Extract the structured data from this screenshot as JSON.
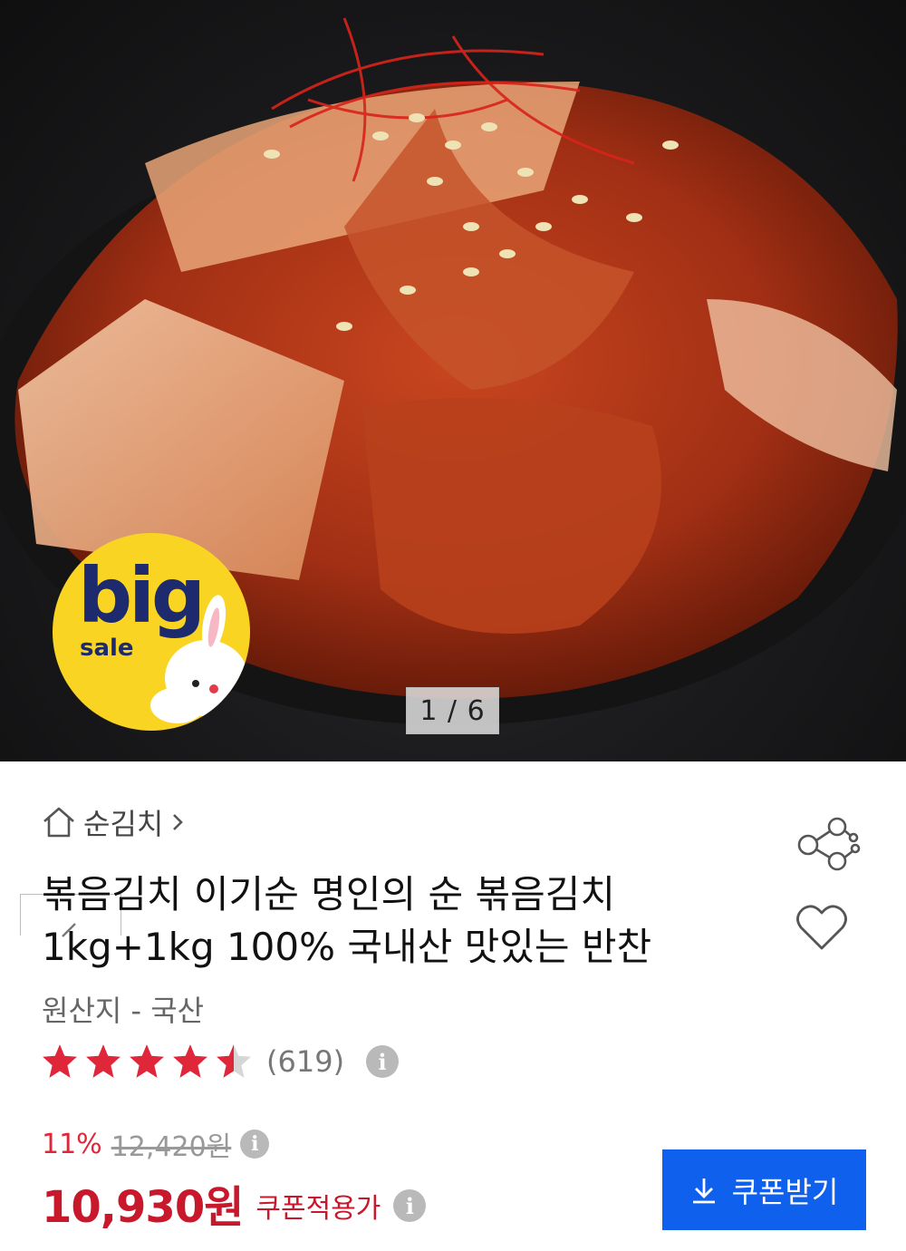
{
  "gallery": {
    "counter": "1 / 6",
    "badge_big": "big",
    "badge_sale": "sale"
  },
  "breadcrumb": {
    "category": "순김치"
  },
  "product": {
    "title_line1": "볶음김치 이기순 명인의 순 볶음김치",
    "title_line2": "1kg+1kg 100% 국내산 맛있는 반찬",
    "origin": "원산지 - 국산",
    "rating_value": 4.5,
    "review_count": "(619)"
  },
  "pricing": {
    "discount_percent": "11%",
    "original_price": "12,420원",
    "sale_price": "10,930원",
    "sale_price_label": "쿠폰적용가"
  },
  "actions": {
    "coupon_button": "쿠폰받기"
  },
  "colors": {
    "accent_red": "#c8182c",
    "button_blue": "#1060ee",
    "star_red": "#e0273a",
    "badge_yellow": "#f9d423"
  },
  "icons": [
    "home-icon",
    "chevron-right-icon",
    "share-icon",
    "heart-icon",
    "info-icon",
    "star-icon",
    "download-icon"
  ]
}
